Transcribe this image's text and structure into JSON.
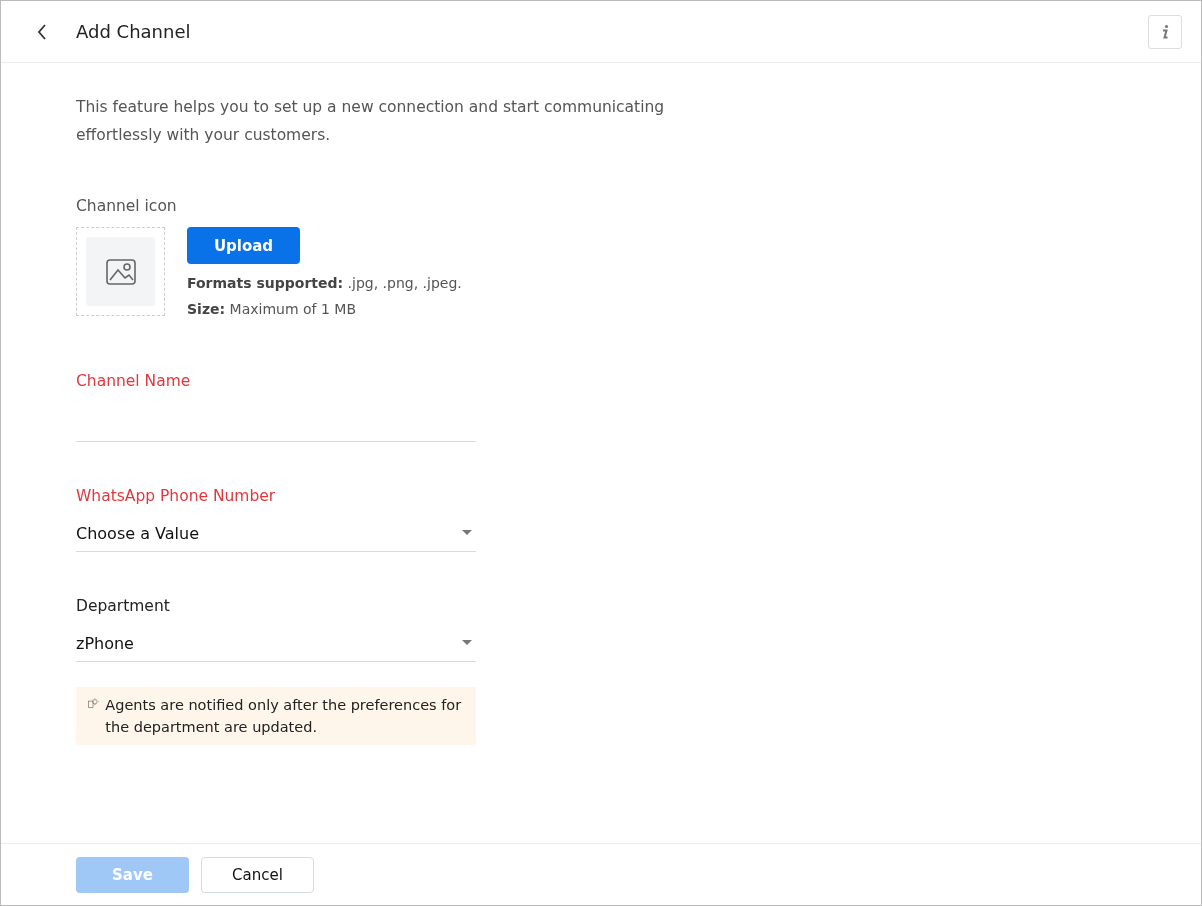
{
  "header": {
    "title": "Add Channel"
  },
  "description": "This feature helps you to set up a new connection and start communicating effortlessly with your customers.",
  "channel_icon": {
    "label": "Channel icon",
    "upload_button": "Upload",
    "formats": "**Formats supported:** .jpg, .png, .jpeg.",
    "size": "**Size:** Maximum of 1 MB"
  },
  "fields": [
    {
      "kind": "text",
      "label": "Channel Name",
      "required": true
    },
    {
      "kind": "select",
      "label": "WhatsApp Phone Number",
      "required": true,
      "value": "Choose a Value"
    },
    {
      "kind": "select",
      "label": "Department",
      "required": false,
      "value": "zPhone"
    }
  ],
  "note": "Agents are notified only after the preferences for the department are updated.",
  "buttons": [
    {
      "label": "Save",
      "kind": "primary",
      "disabled": true
    },
    {
      "label": "Cancel",
      "kind": "secondary",
      "disabled": false
    }
  ]
}
